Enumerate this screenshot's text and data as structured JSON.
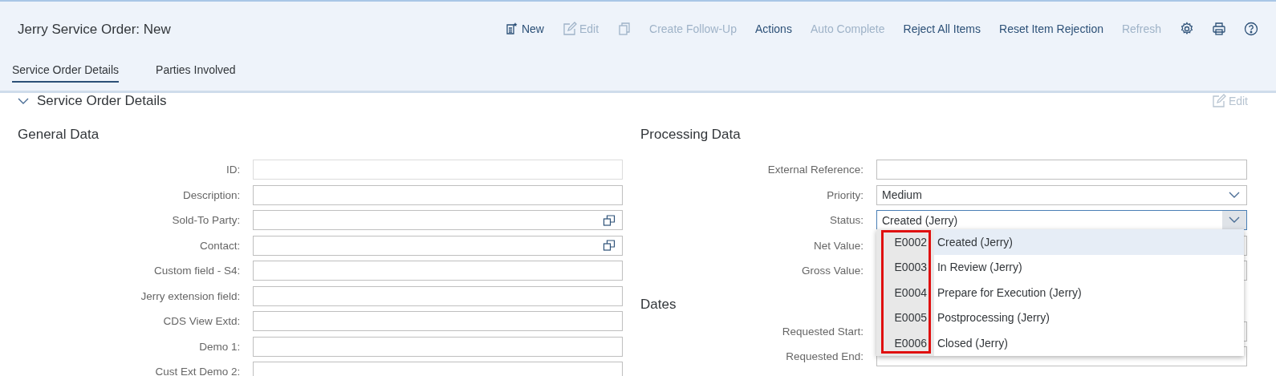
{
  "header": {
    "title": "Jerry Service Order: New",
    "toolbar": [
      {
        "kind": "text",
        "label": "New",
        "disabled": false
      },
      {
        "kind": "text",
        "label": "Edit",
        "disabled": true
      },
      {
        "kind": "icon",
        "disabled": true
      },
      {
        "kind": "text",
        "label": "Create Follow-Up",
        "disabled": true
      },
      {
        "kind": "text",
        "label": "Actions",
        "disabled": false
      },
      {
        "kind": "text",
        "label": "Auto Complete",
        "disabled": true
      },
      {
        "kind": "text",
        "label": "Reject All Items",
        "disabled": false
      },
      {
        "kind": "text",
        "label": "Reset Item Rejection",
        "disabled": false
      },
      {
        "kind": "text",
        "label": "Refresh",
        "disabled": true
      },
      {
        "kind": "icon",
        "disabled": false
      },
      {
        "kind": "icon",
        "disabled": false
      },
      {
        "kind": "icon",
        "disabled": false
      }
    ],
    "tabs": [
      {
        "label": "Service Order Details",
        "selected": true
      },
      {
        "label": "Parties Involved",
        "selected": false
      }
    ]
  },
  "section": {
    "title": "Service Order Details",
    "expanded": true,
    "edit_label": "Edit"
  },
  "general_data": {
    "title": "General Data",
    "fields": [
      {
        "label": "ID:",
        "kind": "text",
        "disabled": true
      },
      {
        "label": "Description:",
        "kind": "text",
        "disabled": false
      },
      {
        "label": "Sold-To Party:",
        "kind": "valuehelp",
        "disabled": false
      },
      {
        "label": "Contact:",
        "kind": "valuehelp",
        "disabled": false
      },
      {
        "label": "Custom field - S4:",
        "kind": "text",
        "disabled": false
      },
      {
        "label": "Jerry extension field:",
        "kind": "text",
        "disabled": false
      },
      {
        "label": "CDS View Extd:",
        "kind": "text",
        "disabled": false
      },
      {
        "label": "Demo 1:",
        "kind": "text",
        "disabled": false
      },
      {
        "label": "Cust Ext Demo 2:",
        "kind": "text",
        "disabled": false
      }
    ]
  },
  "processing_data": {
    "title": "Processing Data",
    "fields": [
      {
        "label": "External Reference:",
        "kind": "text"
      },
      {
        "label": "Priority:",
        "kind": "select",
        "value": "Medium",
        "open": false
      },
      {
        "label": "Status:",
        "kind": "select",
        "value": "Created (Jerry)",
        "open": true
      },
      {
        "label": "Net Value:",
        "kind": "text"
      },
      {
        "label": "Gross Value:",
        "kind": "text"
      }
    ]
  },
  "dates": {
    "title": "Dates",
    "fields": [
      {
        "label": "Requested Start:"
      },
      {
        "label": "Requested End:"
      }
    ]
  },
  "status_dropdown": {
    "code_column_highlighted": true,
    "options": [
      {
        "code": "E0002",
        "text": "Created (Jerry)",
        "selected": true
      },
      {
        "code": "E0003",
        "text": "In Review (Jerry)",
        "selected": false
      },
      {
        "code": "E0004",
        "text": "Prepare for Execution (Jerry)",
        "selected": false
      },
      {
        "code": "E0005",
        "text": "Postprocessing (Jerry)",
        "selected": false
      },
      {
        "code": "E0006",
        "text": "Closed (Jerry)",
        "selected": false
      }
    ]
  }
}
